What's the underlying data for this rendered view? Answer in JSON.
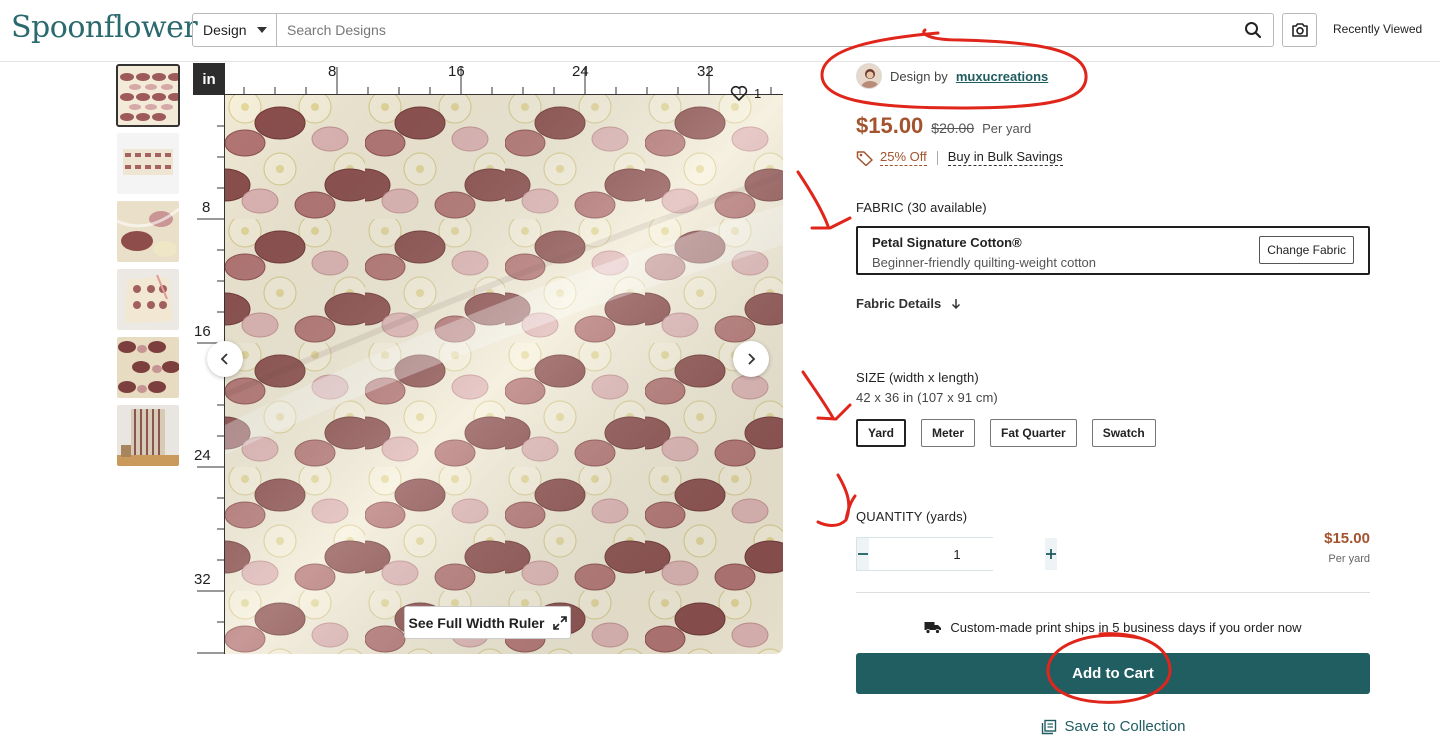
{
  "header": {
    "logo": "Spoonflower",
    "search_type": "Design",
    "search_placeholder": "Search Designs",
    "recently_viewed": "Recently Viewed"
  },
  "viewer": {
    "unit_badge": "in",
    "top_ruler_labels": [
      "8",
      "16",
      "24",
      "32"
    ],
    "left_ruler_labels": [
      "8",
      "16",
      "24",
      "32"
    ],
    "like_count": "1",
    "full_ruler_label": "See Full Width Ruler"
  },
  "product": {
    "designer_prefix": "Design by",
    "designer_name": "muxucreations",
    "price": "$15.00",
    "price_original": "$20.00",
    "price_unit": "Per yard",
    "discount": "25% Off",
    "bulk_link": "Buy in Bulk Savings"
  },
  "fabric": {
    "label": "FABRIC (30 available)",
    "name": "Petal Signature Cotton®",
    "description": "Beginner-friendly quilting-weight cotton",
    "change_button": "Change Fabric",
    "details_link": "Fabric Details"
  },
  "size": {
    "label": "SIZE (width x length)",
    "dimensions": "42 x 36 in (107 x 91 cm)",
    "options": [
      "Yard",
      "Meter",
      "Fat Quarter",
      "Swatch"
    ],
    "selected": "Yard"
  },
  "quantity": {
    "label": "QUANTITY (yards)",
    "value": "1",
    "total_price": "$15.00",
    "total_unit": "Per yard"
  },
  "shipping": {
    "text": "Custom-made print ships in 5 business days if you order now"
  },
  "actions": {
    "add_to_cart": "Add to Cart",
    "save_to_collection": "Save to Collection"
  },
  "colors": {
    "brand_teal": "#205e62",
    "price_rust": "#a3532e",
    "annotation_red": "#e0251b"
  }
}
